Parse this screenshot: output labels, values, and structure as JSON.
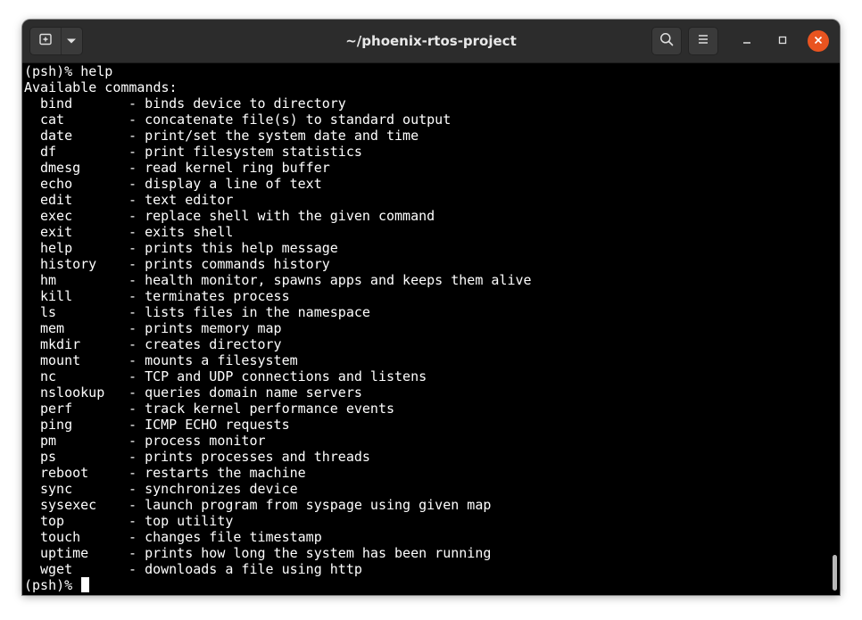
{
  "window": {
    "title": "~/phoenix-rtos-project"
  },
  "titlebar": {
    "new_tab_icon": "new-tab-icon",
    "dropdown_icon": "chevron-down-icon",
    "search_icon": "search-icon",
    "menu_icon": "hamburger-menu-icon",
    "minimize_icon": "minimize-icon",
    "maximize_icon": "maximize-icon",
    "close_icon": "close-icon",
    "close_color": "#e95420"
  },
  "terminal": {
    "first_prompt": "(psh)% help",
    "heading": "Available commands:",
    "separator": "- ",
    "commands": [
      {
        "name": "bind",
        "desc": "binds device to directory"
      },
      {
        "name": "cat",
        "desc": "concatenate file(s) to standard output"
      },
      {
        "name": "date",
        "desc": "print/set the system date and time"
      },
      {
        "name": "df",
        "desc": "print filesystem statistics"
      },
      {
        "name": "dmesg",
        "desc": "read kernel ring buffer"
      },
      {
        "name": "echo",
        "desc": "display a line of text"
      },
      {
        "name": "edit",
        "desc": "text editor"
      },
      {
        "name": "exec",
        "desc": "replace shell with the given command"
      },
      {
        "name": "exit",
        "desc": "exits shell"
      },
      {
        "name": "help",
        "desc": "prints this help message"
      },
      {
        "name": "history",
        "desc": "prints commands history"
      },
      {
        "name": "hm",
        "desc": "health monitor, spawns apps and keeps them alive"
      },
      {
        "name": "kill",
        "desc": "terminates process"
      },
      {
        "name": "ls",
        "desc": "lists files in the namespace"
      },
      {
        "name": "mem",
        "desc": "prints memory map"
      },
      {
        "name": "mkdir",
        "desc": "creates directory"
      },
      {
        "name": "mount",
        "desc": "mounts a filesystem"
      },
      {
        "name": "nc",
        "desc": "TCP and UDP connections and listens"
      },
      {
        "name": "nslookup",
        "desc": "queries domain name servers"
      },
      {
        "name": "perf",
        "desc": "track kernel performance events"
      },
      {
        "name": "ping",
        "desc": "ICMP ECHO requests"
      },
      {
        "name": "pm",
        "desc": "process monitor"
      },
      {
        "name": "ps",
        "desc": "prints processes and threads"
      },
      {
        "name": "reboot",
        "desc": "restarts the machine"
      },
      {
        "name": "sync",
        "desc": "synchronizes device"
      },
      {
        "name": "sysexec",
        "desc": "launch program from syspage using given map"
      },
      {
        "name": "top",
        "desc": "top utility"
      },
      {
        "name": "touch",
        "desc": "changes file timestamp"
      },
      {
        "name": "uptime",
        "desc": "prints how long the system has been running"
      },
      {
        "name": "wget",
        "desc": "downloads a file using http"
      }
    ],
    "last_prompt": "(psh)% "
  }
}
